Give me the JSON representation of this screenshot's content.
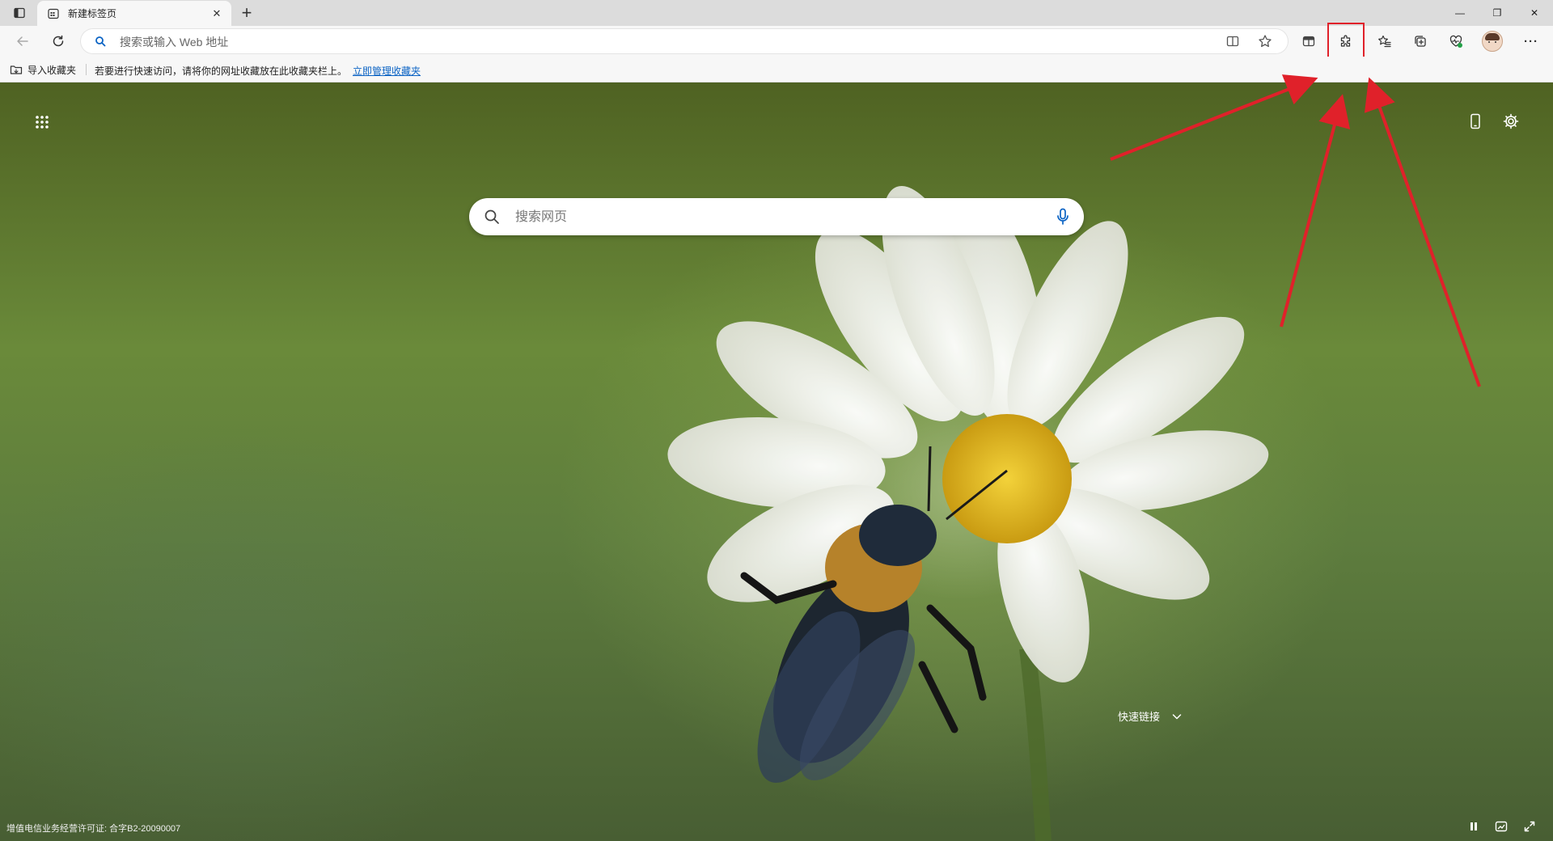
{
  "browser": {
    "tab": {
      "title": "新建标签页",
      "close_symbol": "✕"
    },
    "new_tab_symbol": "+",
    "window_controls": {
      "minimize": "—",
      "restore": "❐",
      "close": "✕"
    }
  },
  "toolbar": {
    "address_placeholder": "搜索或输入 Web 地址",
    "address_value": "",
    "more_symbol": "···"
  },
  "favorites_bar": {
    "import_label": "导入收藏夹",
    "hint_text": "若要进行快速访问，请将你的网址收藏放在此收藏夹栏上。",
    "manage_link": "立即管理收藏夹"
  },
  "new_tab_page": {
    "search_placeholder": "搜索网页",
    "quick_links_label": "快速链接",
    "license_text": "增值电信业务经营许可证: 合字B2-20090007"
  },
  "annotation": {
    "highlight_target": "extensions-icon",
    "highlight_color": "#e0212a"
  },
  "colors": {
    "link": "#0b63c4",
    "tabstrip": "#dcdcdc",
    "toolbar": "#f7f7f7"
  }
}
